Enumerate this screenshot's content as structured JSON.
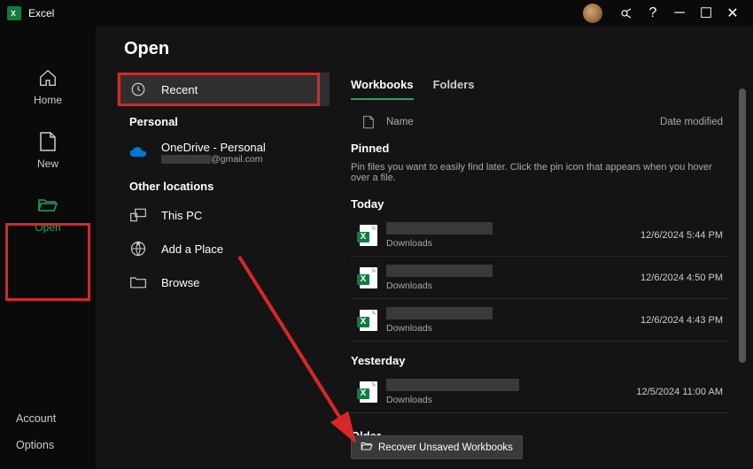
{
  "app": {
    "title": "Excel"
  },
  "titlebar": {
    "help": "?",
    "min": "─",
    "max": "☐",
    "close": "✕"
  },
  "sidebar": {
    "items": [
      {
        "label": "Home"
      },
      {
        "label": "New"
      },
      {
        "label": "Open"
      }
    ],
    "bottom": [
      {
        "label": "Account"
      },
      {
        "label": "Options"
      }
    ]
  },
  "page": {
    "title": "Open",
    "sources": {
      "recent": "Recent",
      "personal_label": "Personal",
      "onedrive": "OneDrive - Personal",
      "onedrive_sub": "@gmail.com",
      "other_label": "Other locations",
      "thispc": "This PC",
      "addplace": "Add a Place",
      "browse": "Browse"
    },
    "tabs": {
      "workbooks": "Workbooks",
      "folders": "Folders"
    },
    "list_header": {
      "name": "Name",
      "date": "Date modified"
    },
    "groups": {
      "pinned": "Pinned",
      "pinned_hint": "Pin files you want to easily find later. Click the pin icon that appears when you hover over a file.",
      "today": "Today",
      "yesterday": "Yesterday",
      "older": "Older"
    },
    "files": {
      "today": [
        {
          "path": "Downloads",
          "date": "12/6/2024 5:44 PM"
        },
        {
          "path": "Downloads",
          "date": "12/6/2024 4:50 PM"
        },
        {
          "path": "Downloads",
          "date": "12/6/2024 4:43 PM"
        }
      ],
      "yesterday": [
        {
          "path": "Downloads",
          "date": "12/5/2024 11:00 AM"
        }
      ]
    },
    "recover_btn": "Recover Unsaved Workbooks"
  }
}
